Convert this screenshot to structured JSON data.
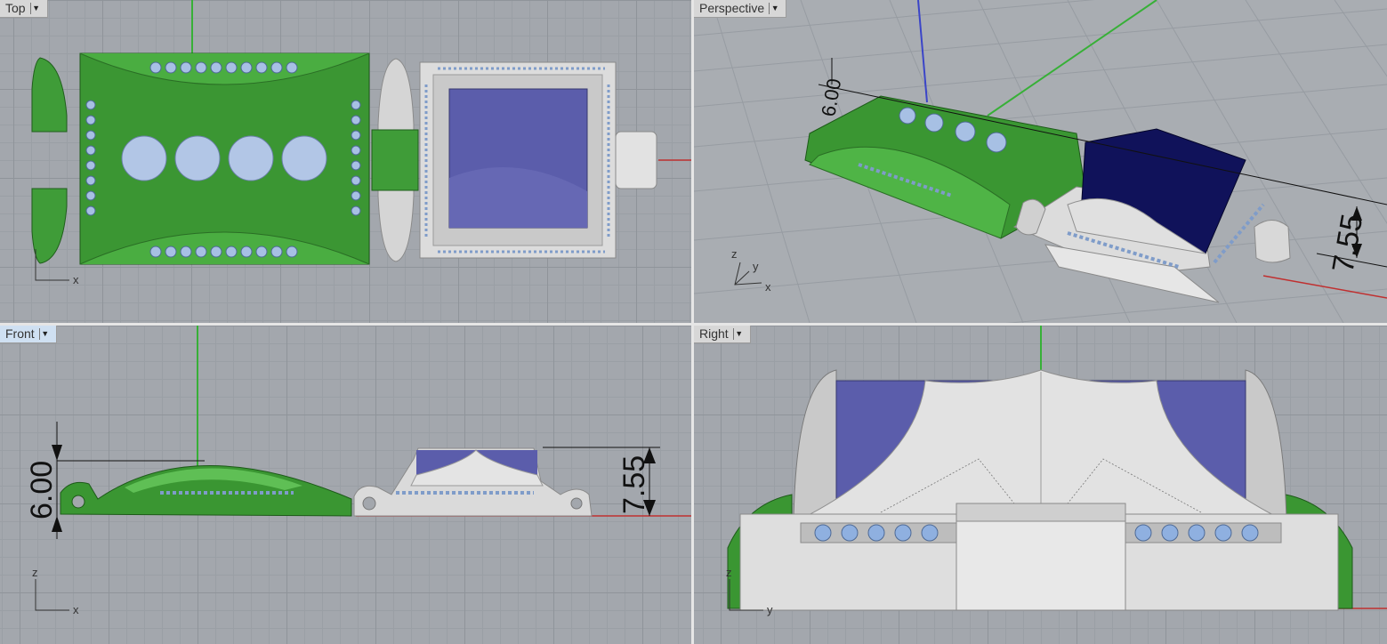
{
  "viewports": {
    "top": {
      "label": "Top"
    },
    "persp": {
      "label": "Perspective"
    },
    "front": {
      "label": "Front"
    },
    "right": {
      "label": "Right"
    }
  },
  "dropdown_icon": "triangle-down",
  "axes": {
    "x": "x",
    "y": "y",
    "z": "z"
  },
  "dimensions": {
    "height_left": "6.00",
    "height_right": "7.55",
    "persp_partial": "6.00"
  },
  "colors": {
    "viewport_bg": "#a3a7ad",
    "metal_green": "#3c9a36",
    "metal_silver": "#d9d9d9",
    "stone_blue": "#5b5dab",
    "gem_light": "#a7c0e4",
    "axis_red": "#c03030",
    "axis_green": "#37b037",
    "axis_blue": "#3b45c8"
  }
}
